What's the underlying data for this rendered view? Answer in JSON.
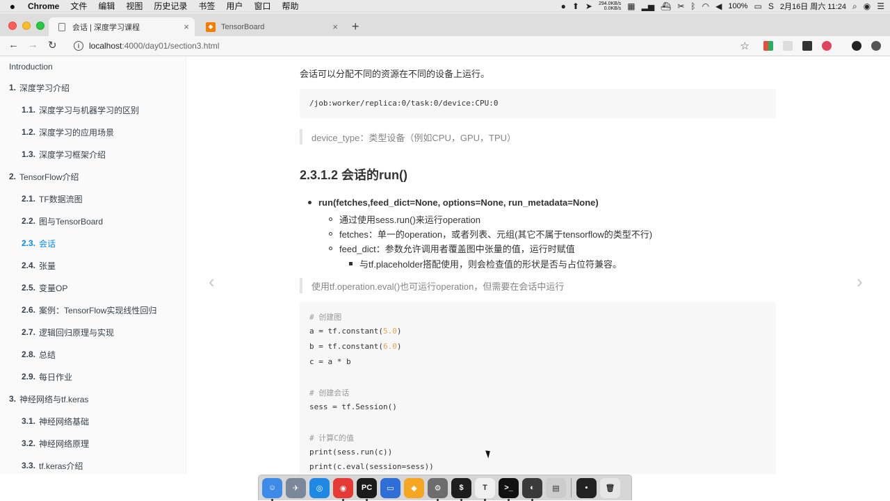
{
  "menubar": {
    "app_name": "Chrome",
    "menus": [
      "文件",
      "编辑",
      "视图",
      "历史记录",
      "书签",
      "用户",
      "窗口",
      "帮助"
    ],
    "net_up": "294.0KB/s",
    "net_down": "0.0KB/s",
    "battery": "100%",
    "datetime": "2月16日 周六 11:24"
  },
  "tabs": [
    {
      "title": "会话 | 深度学习课程",
      "close": "×"
    },
    {
      "title": "TensorBoard",
      "close": "×"
    }
  ],
  "new_tab": "+",
  "toolbar": {
    "back": "←",
    "forward": "→",
    "reload": "↻",
    "url_host": "localhost",
    "url_path": ":4000/day01/section3.html",
    "star": "☆"
  },
  "toc": [
    {
      "num": "",
      "label": "Introduction",
      "level": 1
    },
    {
      "num": "1.",
      "label": "深度学习介绍",
      "level": 1
    },
    {
      "num": "1.1.",
      "label": "深度学习与机器学习的区别",
      "level": 2
    },
    {
      "num": "1.2.",
      "label": "深度学习的应用场景",
      "level": 2
    },
    {
      "num": "1.3.",
      "label": "深度学习框架介绍",
      "level": 2
    },
    {
      "num": "2.",
      "label": "TensorFlow介绍",
      "level": 1
    },
    {
      "num": "2.1.",
      "label": "TF数据流图",
      "level": 2
    },
    {
      "num": "2.2.",
      "label": "图与TensorBoard",
      "level": 2
    },
    {
      "num": "2.3.",
      "label": "会话",
      "level": 2,
      "active": true
    },
    {
      "num": "2.4.",
      "label": "张量",
      "level": 2
    },
    {
      "num": "2.5.",
      "label": "变量OP",
      "level": 2
    },
    {
      "num": "2.6.",
      "label": "案例：TensorFlow实现线性回归",
      "level": 2
    },
    {
      "num": "2.7.",
      "label": "逻辑回归原理与实现",
      "level": 2
    },
    {
      "num": "2.8.",
      "label": "总结",
      "level": 2
    },
    {
      "num": "2.9.",
      "label": "每日作业",
      "level": 2
    },
    {
      "num": "3.",
      "label": "神经网络与tf.keras",
      "level": 1
    },
    {
      "num": "3.1.",
      "label": "神经网络基础",
      "level": 2
    },
    {
      "num": "3.2.",
      "label": "神经网络原理",
      "level": 2
    },
    {
      "num": "3.3.",
      "label": "tf.keras介绍",
      "level": 2
    }
  ],
  "nav": {
    "prev": "‹",
    "next": "›"
  },
  "content": {
    "intro": "会话可以分配不同的资源在不同的设备上运行。",
    "device_code": "/job:worker/replica:0/task:0/device:CPU:0",
    "device_quote": "device_type：类型设备（例如CPU，GPU，TPU）",
    "heading": "2.3.1.2 会话的run()",
    "run_signature": "run(fetches,feed_dict=None, options=None, run_metadata=None)",
    "sub1": "通过使用sess.run()来运行operation",
    "sub2": "fetches：单一的operation，或者列表、元组(其它不属于tensorflow的类型不行)",
    "sub3": "feed_dict：参数允许调用者覆盖图中张量的值，运行时赋值",
    "sub3_1": "与tf.placeholder搭配使用，则会检查值的形状是否与占位符兼容。",
    "eval_quote": "使用tf.operation.eval()也可运行operation，但需要在会话中运行",
    "code": {
      "c1": "# 创建图",
      "a_pre": "a = tf.constant(",
      "a_num": "5.0",
      "a_post": ")",
      "b_pre": "b = tf.constant(",
      "b_num": "6.0",
      "b_post": ")",
      "c_line": "c = a * b",
      "c2": "# 创建会话",
      "sess_line": "sess = tf.Session()",
      "c3": "# 计算C的值",
      "print1": "print(sess.run(c))",
      "print2": "print(c.eval(session=sess))"
    }
  },
  "dock": [
    "Finder",
    "Launchpad",
    "Safari",
    "Chrome",
    "PyCharm",
    "Keynote",
    "Sketch",
    "System Preferences",
    "Terminal",
    "Typora",
    "iTerm",
    "OBS",
    "Preview",
    "Terminal 2",
    "Trash"
  ]
}
